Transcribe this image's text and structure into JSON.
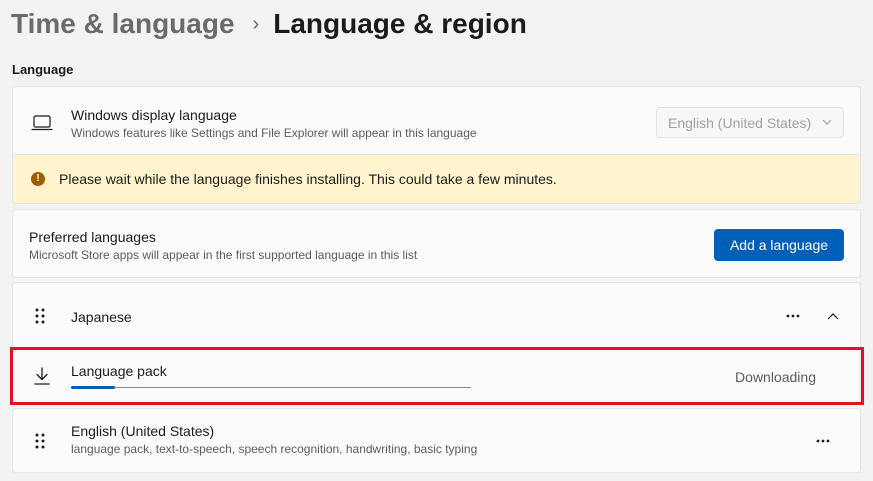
{
  "breadcrumb": {
    "parent": "Time & language",
    "separator": "›",
    "current": "Language & region"
  },
  "section": {
    "language_label": "Language"
  },
  "display_language": {
    "title": "Windows display language",
    "subtitle": "Windows features like Settings and File Explorer will appear in this language",
    "dropdown_value": "English (United States)",
    "icon": "laptop-icon"
  },
  "banner": {
    "text": "Please wait while the language finishes installing. This could take a few minutes.",
    "icon": "warning-icon",
    "color": "#fff4ce"
  },
  "preferred": {
    "title": "Preferred languages",
    "subtitle": "Microsoft Store apps will appear in the first supported language in this list",
    "add_button": "Add a language"
  },
  "languages": [
    {
      "name": "Japanese",
      "expanded": true,
      "features": [
        {
          "name": "Language pack",
          "status": "Downloading",
          "progress": 0.11,
          "icon": "download-icon"
        }
      ]
    },
    {
      "name": "English (United States)",
      "subtitle": "language pack, text-to-speech, speech recognition, handwriting, basic typing"
    }
  ],
  "colors": {
    "accent": "#005fb8",
    "highlight_border": "#e81123"
  }
}
